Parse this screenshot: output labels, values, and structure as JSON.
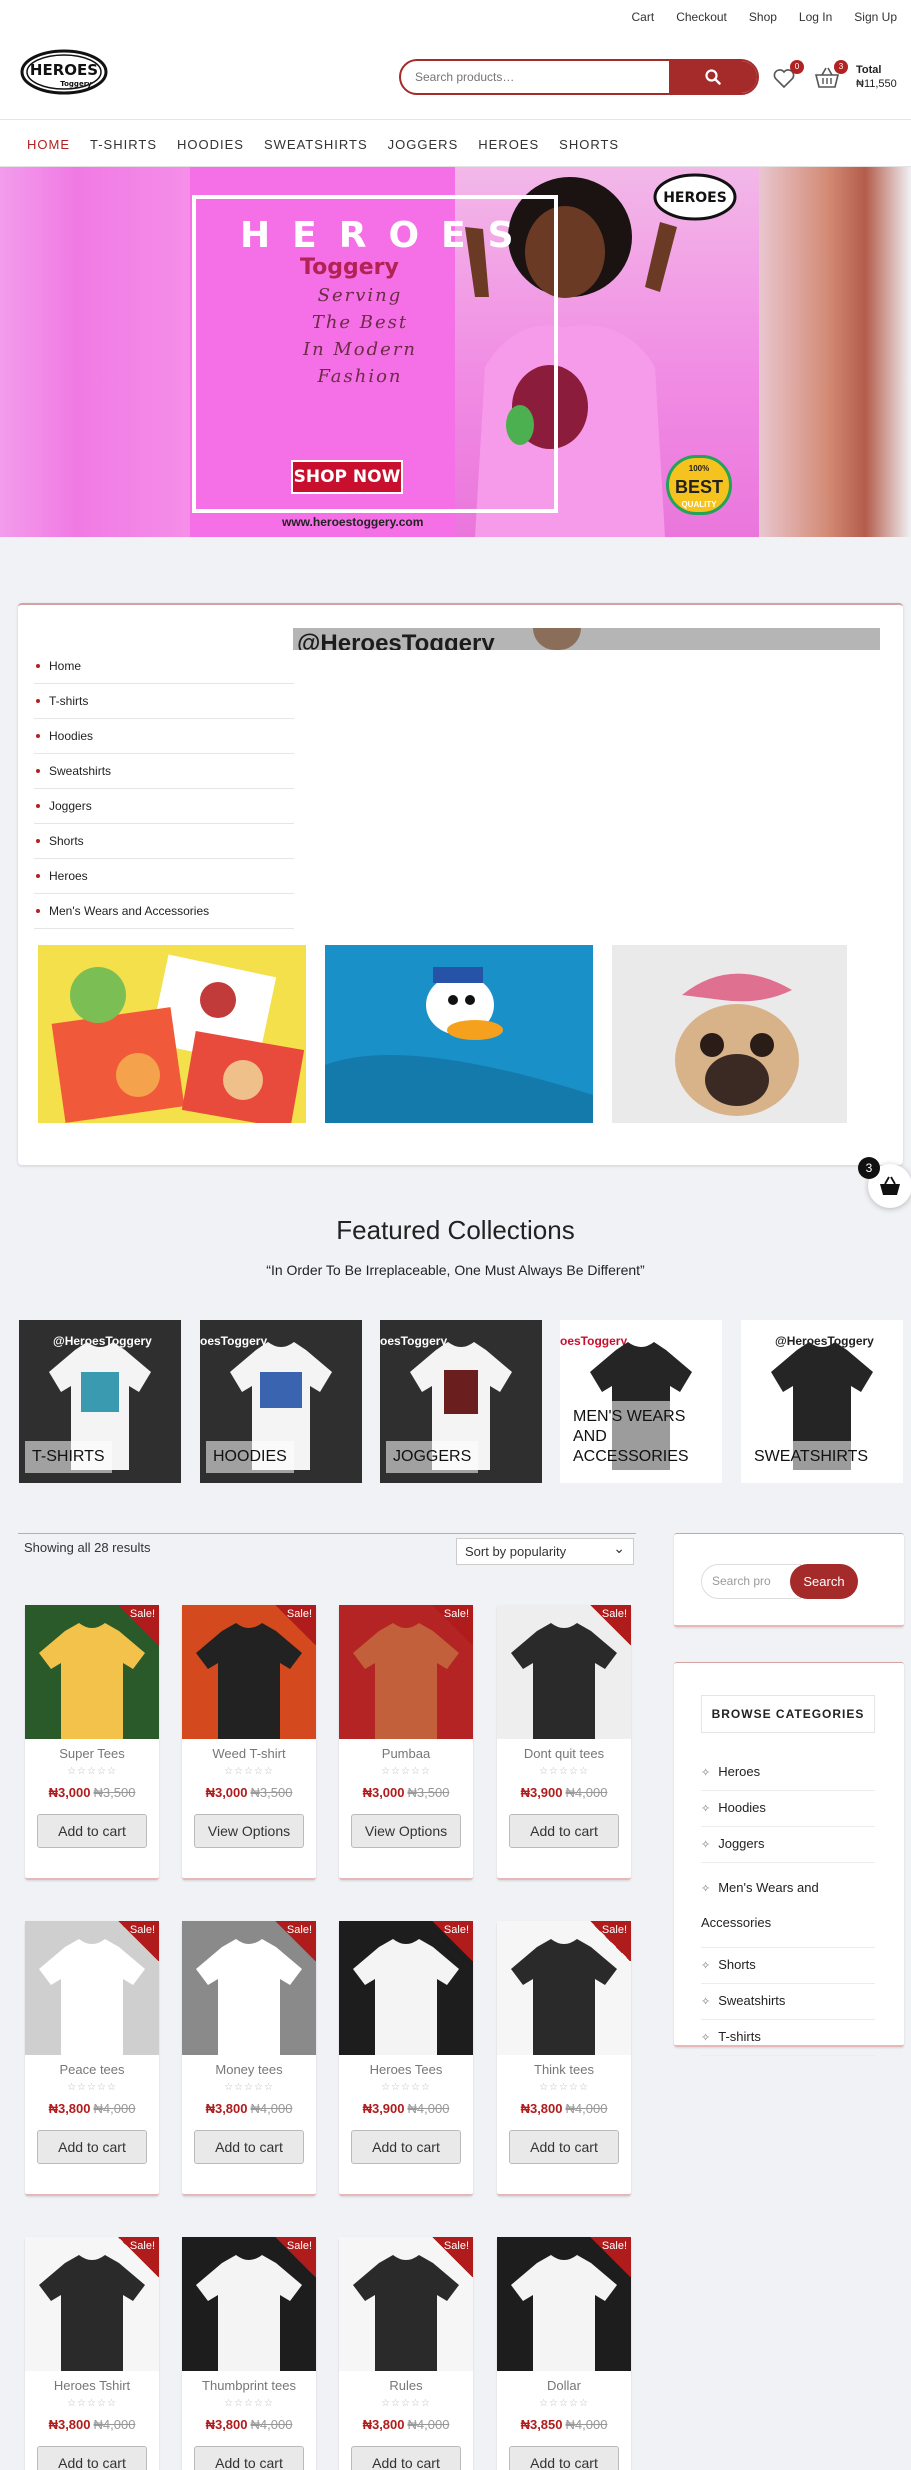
{
  "toplinks": [
    "Cart",
    "Checkout",
    "Shop",
    "Log In",
    "Sign Up"
  ],
  "header": {
    "logo_text": "HEROES",
    "logo_sub": "Toggery",
    "search_placeholder": "Search products…",
    "wishlist_count": "0",
    "cart_count": "3",
    "total_label": "Total",
    "total_value": "₦11,550"
  },
  "nav": [
    "HOME",
    "T-SHIRTS",
    "HOODIES",
    "SWEATSHIRTS",
    "JOGGERS",
    "HEROES",
    "SHORTS"
  ],
  "hero": {
    "title": "HEROES",
    "sub": "Toggery",
    "slogan": "Serving The Best In Modern Fashion",
    "shop_btn": "SHOP NOW",
    "url": "www.heroestoggery.com",
    "badge": "BEST",
    "badge_top": "100%",
    "badge_bottom": "QUALITY"
  },
  "block": {
    "categories": [
      "Home",
      "T-shirts",
      "Hoodies",
      "Sweatshirts",
      "Joggers",
      "Shorts",
      "Heroes",
      "Men's Wears and Accessories"
    ],
    "insta_handle": "@HeroesToggery"
  },
  "featured": {
    "title": "Featured Collections",
    "subtitle": "“In Order To Be Irreplaceable, One Must Always Be Different”",
    "collections": [
      {
        "label": "T-SHIRTS",
        "brand": "@HeroesToggery"
      },
      {
        "label": "HOODIES",
        "brand": "oesToggery"
      },
      {
        "label": "JOGGERS",
        "brand": "oesToggery"
      },
      {
        "label": "MEN'S WEARS AND ACCESSORIES",
        "brand": "oesToggery"
      },
      {
        "label": "SWEATSHIRTS",
        "brand": "@HeroesToggery"
      }
    ]
  },
  "shop": {
    "showing": "Showing all 28 results",
    "sort": "Sort by popularity",
    "sale_label": "Sale!",
    "stars": "☆☆☆☆☆",
    "products": [
      {
        "name": "Super Tees",
        "price": "₦3,000",
        "was": "₦3,500",
        "btn": "Add to cart"
      },
      {
        "name": "Weed T-shirt",
        "price": "₦3,000",
        "was": "₦3,500",
        "btn": "View Options"
      },
      {
        "name": "Pumbaa",
        "price": "₦3,000",
        "was": "₦3,500",
        "btn": "View Options"
      },
      {
        "name": "Dont quit tees",
        "price": "₦3,900",
        "was": "₦4,000",
        "btn": "Add to cart"
      },
      {
        "name": "Peace tees",
        "price": "₦3,800",
        "was": "₦4,000",
        "btn": "Add to cart"
      },
      {
        "name": "Money tees",
        "price": "₦3,800",
        "was": "₦4,000",
        "btn": "Add to cart"
      },
      {
        "name": "Heroes Tees",
        "price": "₦3,900",
        "was": "₦4,000",
        "btn": "Add to cart"
      },
      {
        "name": "Think tees",
        "price": "₦3,800",
        "was": "₦4,000",
        "btn": "Add to cart"
      },
      {
        "name": "Heroes Tshirt",
        "price": "₦3,800",
        "was": "₦4,000",
        "btn": "Add to cart"
      },
      {
        "name": "Thumbprint tees",
        "price": "₦3,800",
        "was": "₦4,000",
        "btn": "Add to cart"
      },
      {
        "name": "Rules",
        "price": "₦3,800",
        "was": "₦4,000",
        "btn": "Add to cart"
      },
      {
        "name": "Dollar",
        "price": "₦3,850",
        "was": "₦4,000",
        "btn": "Add to cart"
      }
    ]
  },
  "sidebar": {
    "search_placeholder": "Search pro",
    "search_btn": "Search",
    "cats_heading": "BROWSE CATEGORIES",
    "categories": [
      "Heroes",
      "Hoodies",
      "Joggers",
      "Men's Wears and Accessories",
      "Shorts",
      "Sweatshirts",
      "T-shirts"
    ]
  },
  "floating_cart_count": "3",
  "colors": {
    "accent": "#a52a2a",
    "sale": "#b01c1c",
    "hero_pink": "#f56fe6"
  }
}
